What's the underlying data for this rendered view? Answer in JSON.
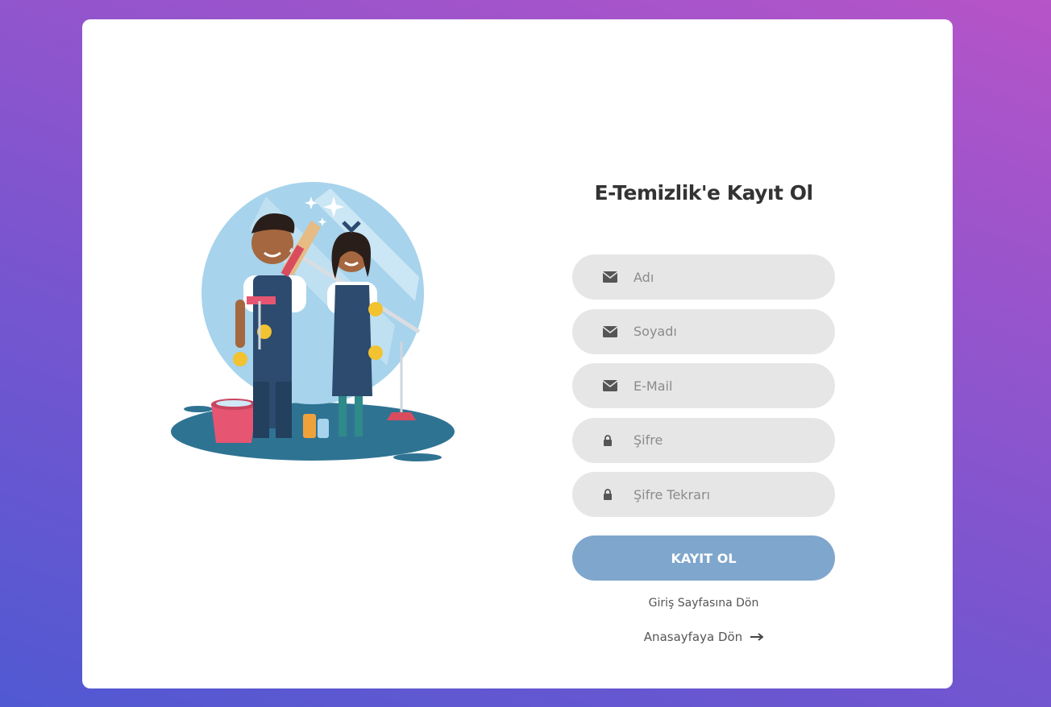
{
  "form": {
    "title": "E-Temizlik'e Kayıt Ol",
    "fields": [
      {
        "placeholder": "Adı",
        "icon": "envelope-icon"
      },
      {
        "placeholder": "Soyadı",
        "icon": "envelope-icon"
      },
      {
        "placeholder": "E-Mail",
        "icon": "envelope-icon"
      },
      {
        "placeholder": "Şifre",
        "icon": "lock-icon"
      },
      {
        "placeholder": "Şifre Tekrarı",
        "icon": "lock-icon"
      }
    ],
    "submit_label": "KAYIT OL",
    "login_link": "Giriş Sayfasına Dön",
    "home_link": "Anasayfaya Dön",
    "home_icon": "arrow-right-icon"
  },
  "illustration": {
    "icon": "cleaning-workers-illustration"
  },
  "colors": {
    "background_start": "#5059d2",
    "background_end": "#b654c8",
    "card": "#ffffff",
    "field_bg": "#e6e6e6",
    "button": "#7fa6cc"
  }
}
